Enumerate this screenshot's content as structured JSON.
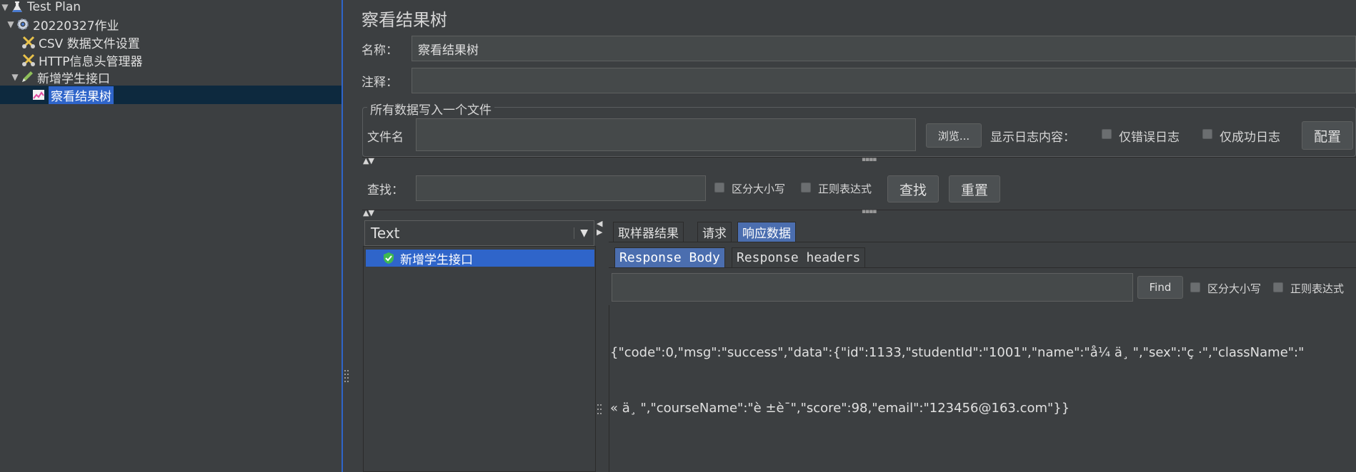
{
  "tree": {
    "items": [
      {
        "label": "Test Plan",
        "icon": "flask-icon"
      },
      {
        "label": "20220327作业",
        "icon": "gear-icon"
      },
      {
        "label": "CSV 数据文件设置",
        "icon": "scissors-icon"
      },
      {
        "label": "HTTP信息头管理器",
        "icon": "scissors-icon"
      },
      {
        "label": "新增学生接口",
        "icon": "pen-icon"
      },
      {
        "label": "察看结果树",
        "icon": "chart-icon"
      }
    ]
  },
  "panel": {
    "title": "察看结果树",
    "name_label": "名称：",
    "name_value": "察看结果树",
    "comment_label": "注释：",
    "comment_value": "",
    "group_title": "所有数据写入一个文件",
    "filename_label": "文件名",
    "filename_value": "",
    "browse_button": "浏览...",
    "log_label": "显示日志内容：",
    "errors_only": "仅错误日志",
    "success_only": "仅成功日志",
    "config_button": "配置"
  },
  "search": {
    "label": "查找：",
    "value": "",
    "case_sensitive": "区分大小写",
    "regex": "正则表达式",
    "find_button": "查找",
    "reset_button": "重置"
  },
  "renderer": {
    "selected": "Text"
  },
  "results": {
    "items": [
      {
        "label": "新增学生接口",
        "status": "success"
      }
    ]
  },
  "tabs": {
    "main": [
      "取样器结果",
      "请求",
      "响应数据"
    ],
    "active_main": "响应数据",
    "sub": [
      "Response Body",
      "Response headers"
    ],
    "active_sub": "Response Body"
  },
  "response_search": {
    "value": "",
    "find_button": "Find",
    "case_sensitive": "区分大小写",
    "regex": "正则表达式"
  },
  "response": {
    "line1": "{\"code\":0,\"msg\":\"success\",\"data\":{\"id\":1133,\"studentId\":\"1001\",\"name\":\"å¼ ä¸ \",\"sex\":\"ç ·\",\"className\":\"",
    "line2": "« ä¸ \",\"courseName\":\"è ±è¯­\",\"score\":98,\"email\":\"123456@163.com\"}}"
  },
  "colors": {
    "background": "#3c3f41",
    "selection": "#2f65ca",
    "tree_selected_row": "#0d293e",
    "active_tab": "#4b6eaf",
    "success": "#3fb950"
  }
}
